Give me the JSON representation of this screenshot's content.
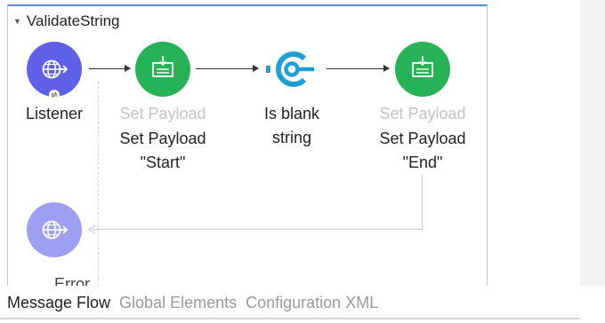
{
  "flow": {
    "name": "ValidateString"
  },
  "nodes": {
    "listener": {
      "label": "Listener"
    },
    "set_payload_start": {
      "type_label": "Set Payload",
      "name_line1": "Set Payload",
      "name_line2": "\"Start\""
    },
    "is_blank": {
      "name_line1": "Is blank",
      "name_line2": "string"
    },
    "set_payload_end": {
      "type_label": "Set Payload",
      "name_line1": "Set Payload",
      "name_line2": "\"End\""
    },
    "error_handler": {
      "label": "Error"
    }
  },
  "tabs": [
    {
      "label": "Message Flow",
      "active": true
    },
    {
      "label": "Global Elements",
      "active": false
    },
    {
      "label": "Configuration XML",
      "active": false
    }
  ],
  "colors": {
    "listener": "#5e61e8",
    "error_node": "#9d9ff0",
    "set_payload": "#27b257",
    "is_blank_icon": "#1f9fd6",
    "flow_border_top": "#5b8fd4"
  },
  "icons": {
    "listener": "globe-arrow-icon",
    "set_payload": "payload-download-icon",
    "is_blank": "connector-icon",
    "error": "globe-arrow-icon"
  }
}
